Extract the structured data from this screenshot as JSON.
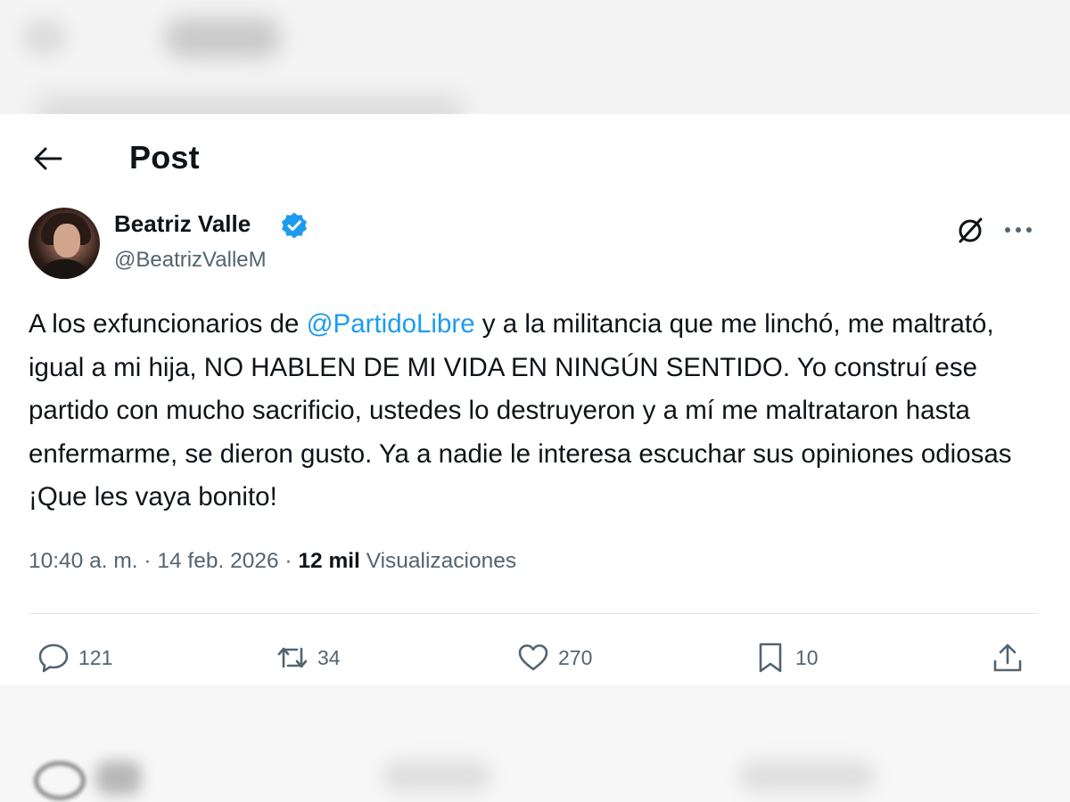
{
  "header": {
    "title": "Post",
    "back_icon": "arrow-left-icon"
  },
  "author": {
    "name": "Beatriz Valle",
    "handle": "@BeatrizValleM",
    "verified_color": "#1d9bf0"
  },
  "post": {
    "text_parts": [
      "A los exfuncionarios de ",
      "@PartidoLibre",
      " y a la militancia que me linchó, me maltrató, igual a mi hija, NO HABLEN DE MI VIDA EN NINGÚN SENTIDO. Yo construí ese partido con mucho sacrificio, ustedes lo destruyeron y a mí me maltrataron hasta enfermarme, se dieron gusto. Ya a nadie le interesa escuchar sus opiniones odiosas ¡Que les vaya bonito!"
    ],
    "time": "10:40 a. m.",
    "separator": "·",
    "date": "14 feb. 2026",
    "views_count": "12 mil",
    "views_label": "Visualizaciones"
  },
  "actions": {
    "replies": "121",
    "reposts": "34",
    "likes": "270",
    "bookmarks": "10"
  },
  "colors": {
    "text": "#0f1419",
    "muted": "#536471",
    "accent": "#1d9bf0"
  }
}
